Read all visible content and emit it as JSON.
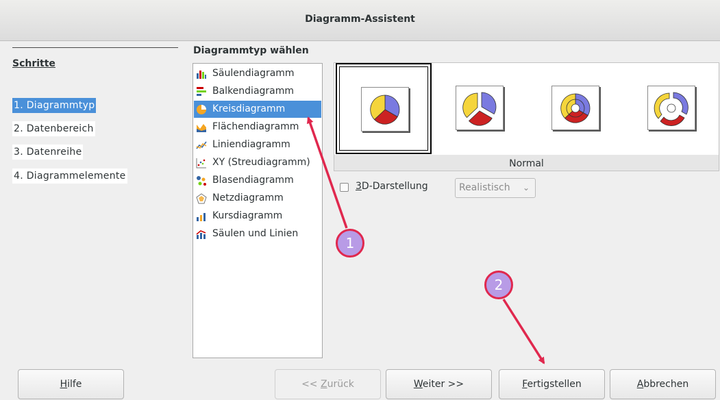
{
  "window": {
    "title": "Diagramm-Assistent"
  },
  "steps": {
    "heading": "Schritte",
    "items": [
      {
        "label": "1. Diagrammtyp",
        "selected": true
      },
      {
        "label": "2. Datenbereich",
        "selected": false
      },
      {
        "label": "3. Datenreihe",
        "selected": false
      },
      {
        "label": "4. Diagrammelemente",
        "selected": false
      }
    ]
  },
  "chart_types": {
    "heading": "Diagrammtyp wählen",
    "items": [
      {
        "label": "Säulendiagramm",
        "icon": "column-chart-icon",
        "selected": false
      },
      {
        "label": "Balkendiagramm",
        "icon": "bar-chart-icon",
        "selected": false
      },
      {
        "label": "Kreisdiagramm",
        "icon": "pie-chart-icon",
        "selected": true
      },
      {
        "label": "Flächendiagramm",
        "icon": "area-chart-icon",
        "selected": false
      },
      {
        "label": "Liniendiagramm",
        "icon": "line-chart-icon",
        "selected": false
      },
      {
        "label": "XY (Streudiagramm)",
        "icon": "scatter-chart-icon",
        "selected": false
      },
      {
        "label": "Blasendiagramm",
        "icon": "bubble-chart-icon",
        "selected": false
      },
      {
        "label": "Netzdiagramm",
        "icon": "net-chart-icon",
        "selected": false
      },
      {
        "label": "Kursdiagramm",
        "icon": "stock-chart-icon",
        "selected": false
      },
      {
        "label": "Säulen und Linien",
        "icon": "column-line-chart-icon",
        "selected": false
      }
    ]
  },
  "variants": {
    "selected_label": "Normal",
    "items": [
      {
        "icon": "pie-normal-icon",
        "selected": true
      },
      {
        "icon": "pie-exploded-icon",
        "selected": false
      },
      {
        "icon": "donut-icon",
        "selected": false
      },
      {
        "icon": "donut-exploded-icon",
        "selected": false
      }
    ]
  },
  "options": {
    "three_d_label": "3D-Darstellung",
    "three_d_checked": false,
    "style_value": "Realistisch"
  },
  "buttons": {
    "help": "Hilfe",
    "back": "<< Zurück",
    "next": "Weiter >>",
    "finish": "Fertigstellen",
    "cancel": "Abbrechen"
  },
  "annotations": {
    "badge1": "1",
    "badge2": "2"
  },
  "colors": {
    "selection": "#4a90d9",
    "annotation": "#e0284e",
    "badge_fill": "#b89be6",
    "pie_yellow": "#f5d53c",
    "pie_blue": "#7a7ae0",
    "pie_red": "#cc2222"
  }
}
